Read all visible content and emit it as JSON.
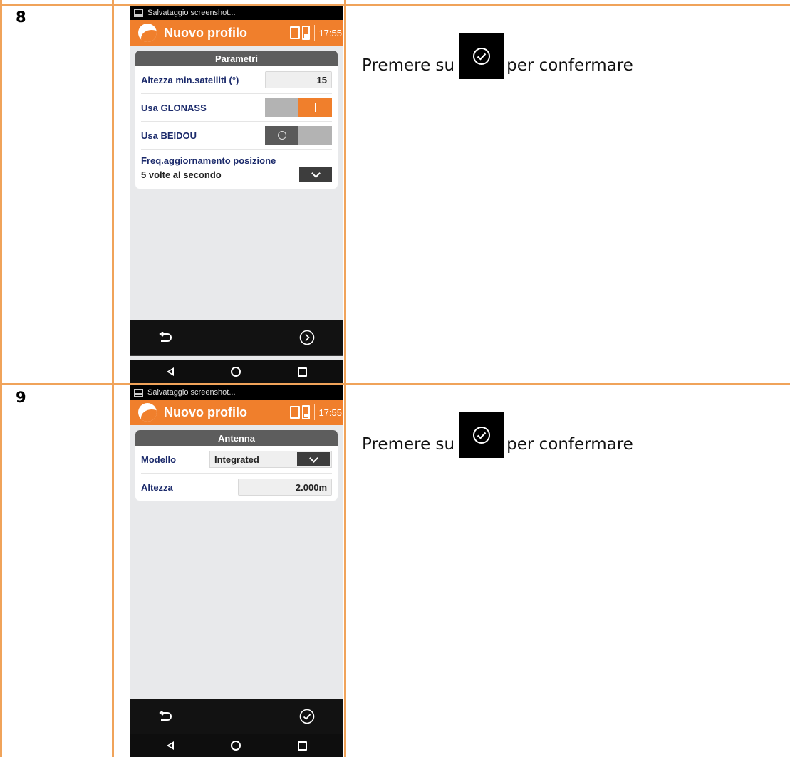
{
  "colors": {
    "table_border": "#f0a35a",
    "app_accent": "#f07f2c",
    "label_navy": "#1b2a6b",
    "panel_header": "#5d5d5d"
  },
  "steps": [
    {
      "number": "8",
      "instruction": {
        "before": "Premere su",
        "icon": "check-circle-icon",
        "after": "per confermare"
      },
      "screen": {
        "status_text": "Salvataggio screenshot...",
        "app_title": "Nuovo profilo",
        "clock": "17:55",
        "panel_title": "Parametri",
        "fields": {
          "min_altitude_label": "Altezza min.satelliti (°)",
          "min_altitude_value": "15",
          "glonass_label": "Usa GLONASS",
          "glonass_on": true,
          "beidou_label": "Usa BEIDOU",
          "beidou_on": false,
          "freq_label": "Freq.aggiornamento posizione",
          "freq_value": "5 volte al secondo"
        },
        "toolbar": {
          "left": "back-arrow-icon",
          "right": "next-circle-icon"
        }
      }
    },
    {
      "number": "9",
      "instruction": {
        "before": "Premere su",
        "icon": "check-circle-icon",
        "after": "per confermare"
      },
      "screen": {
        "status_text": "Salvataggio screenshot...",
        "app_title": "Nuovo profilo",
        "clock": "17:55",
        "panel_title": "Antenna",
        "fields": {
          "model_label": "Modello",
          "model_value": "Integrated",
          "height_label": "Altezza",
          "height_value": "2.000m"
        },
        "toolbar": {
          "left": "back-arrow-icon",
          "right": "check-circle-icon"
        }
      }
    }
  ]
}
